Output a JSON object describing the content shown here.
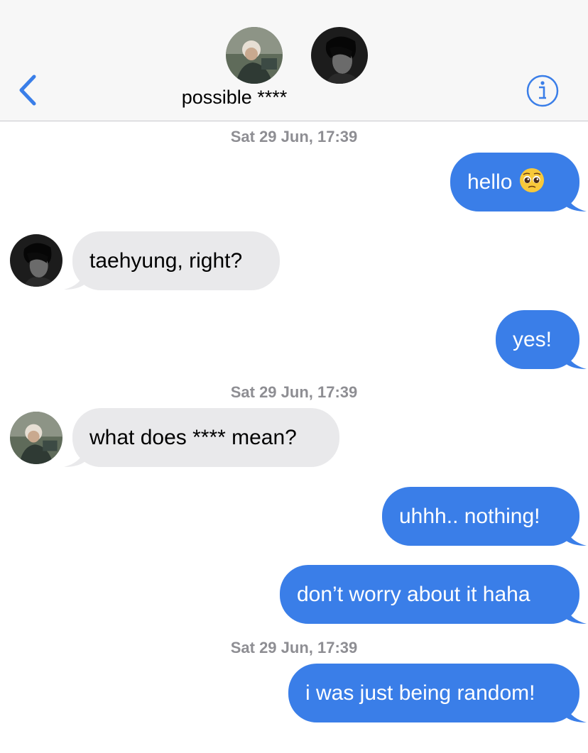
{
  "header": {
    "title": "possible ****",
    "back_icon": "chevron-left-icon",
    "info_icon": "info-icon",
    "accent_color": "#3a7ee8"
  },
  "thread": {
    "timestamps": [
      "Sat 29 Jun, 17:39",
      "Sat 29 Jun, 17:39",
      "Sat 29 Jun, 17:39"
    ],
    "messages": [
      {
        "direction": "outgoing",
        "text": "hello",
        "emoji": "pleading-face-emoji"
      },
      {
        "direction": "incoming",
        "sender_avatar": "avatar-dark-hair",
        "text": "taehyung, right?"
      },
      {
        "direction": "outgoing",
        "text": "yes!"
      },
      {
        "direction": "incoming",
        "sender_avatar": "avatar-light-hair",
        "text": "what does **** mean?"
      },
      {
        "direction": "outgoing",
        "text": "uhhh.. nothing!"
      },
      {
        "direction": "outgoing",
        "text": "don’t worry about it haha"
      },
      {
        "direction": "outgoing",
        "text": "i was just being random!"
      }
    ]
  },
  "colors": {
    "outgoing_bubble": "#3a7ee8",
    "incoming_bubble": "#e9e9eb",
    "timestamp": "#8e8e93"
  }
}
